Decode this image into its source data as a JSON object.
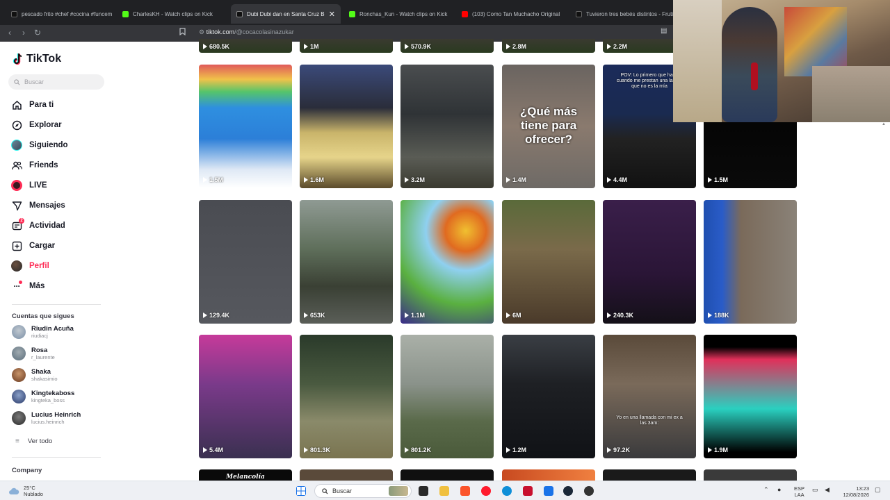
{
  "browser": {
    "tabs": [
      {
        "title": "pescado frito #chef #cocina #funcem",
        "favicon_color": "#111111"
      },
      {
        "title": "CharlesKH - Watch clips on Kick",
        "favicon_color": "#53fc18"
      },
      {
        "title": "Dubi Dubi dan en Santa Cruz Bol",
        "favicon_color": "#111111",
        "active": true
      },
      {
        "title": "Ronchas_Kun - Watch clips on Kick",
        "favicon_color": "#53fc18"
      },
      {
        "title": "(103) Como Tan Muchacho Original",
        "favicon_color": "#ff0000"
      },
      {
        "title": "Tuvieron tres bebés distintos - Fruti",
        "favicon_color": "#111111"
      }
    ],
    "url_host": "tiktok.com",
    "url_path": "/@cocacolasinazukar"
  },
  "sidebar": {
    "logo": "TikTok",
    "search_placeholder": "Buscar",
    "nav": [
      {
        "label": "Para ti",
        "icon": "home-icon"
      },
      {
        "label": "Explorar",
        "icon": "compass-icon"
      },
      {
        "label": "Siguiendo",
        "icon": "avatar-icon"
      },
      {
        "label": "Friends",
        "icon": "friends-icon"
      },
      {
        "label": "LIVE",
        "icon": "live-icon"
      },
      {
        "label": "Mensajes",
        "icon": "send-icon"
      },
      {
        "label": "Actividad",
        "icon": "activity-icon",
        "badge": "2"
      },
      {
        "label": "Cargar",
        "icon": "upload-icon"
      },
      {
        "label": "Perfil",
        "icon": "profile-icon"
      },
      {
        "label": "Más",
        "icon": "more-icon"
      }
    ],
    "following_title": "Cuentas que sigues",
    "following": [
      {
        "name": "Riudin Acuña",
        "user": "riudiacj",
        "color": "#7a8fa6"
      },
      {
        "name": "Rosa",
        "user": "r_laurente",
        "color": "#5b6e7c"
      },
      {
        "name": "Shaka",
        "user": "shakasimio",
        "color": "#8a5a3c"
      },
      {
        "name": "Kingtekaboss",
        "user": "kingteka_boss",
        "color": "#3d5a8a"
      },
      {
        "name": "Lucius Heinrich",
        "user": "lucius.heinrich",
        "color": "#4a4a4a"
      }
    ],
    "see_all": "Ver todo",
    "company": "Company"
  },
  "grid": {
    "top_row_views": [
      "680.5K",
      "1M",
      "570.9K",
      "2.8M",
      "2.2M"
    ],
    "rows": [
      [
        {
          "views": "1.5M",
          "bg": "linear-gradient(180deg,#e05a5a 0%,#f0c24a 12%,#55c46a 22%,#2e8fe0 35%,#2c7fd8 60%,#dfe9f5 85%,#ffffff 100%)"
        },
        {
          "views": "1.6M",
          "bg": "linear-gradient(180deg,#3b4a7a 0%,#2a2d3a 35%,#c9b46a 55%,#e6d48a 75%,#5a4a2a 100%)"
        },
        {
          "views": "3.2M",
          "bg": "linear-gradient(180deg,#4a4d4f 0%,#2f3336 40%,#5a5c55 75%,#3a3a30 100%)"
        },
        {
          "views": "1.4M",
          "bg": "linear-gradient(180deg,#6a6460 0%,#8a7a6e 50%,#6e6a66 100%)",
          "overlay": "¿Qué más tiene para ofrecer?"
        },
        {
          "views": "4.4M",
          "bg": "linear-gradient(180deg,#1b2b5a 0%,#1a2a50 40%,#222 60%,#111 100%)",
          "overlay_small": "POV: Lo primero que hago cuando me prestan una laptop que no es la mía"
        },
        {
          "views": "1.5M",
          "bg": "linear-gradient(180deg,#000 0%,#0a0a0a 100%)"
        }
      ],
      [
        {
          "views": "129.4K",
          "bg": "linear-gradient(180deg,#4a4c52 0%,#56585e 100%)"
        },
        {
          "views": "653K",
          "bg": "linear-gradient(180deg,#8f9a93 0%,#5e6e5a 40%,#3a4034 70%,#5a5e58 100%)"
        },
        {
          "views": "1.1M",
          "bg": "radial-gradient(circle at 70% 25%,#f0c030 0%,#e06a20 18%,#8fd0f0 35%,#5ab040 65%,#3a2a8a 100%)"
        },
        {
          "views": "6M",
          "bg": "linear-gradient(180deg,#5a6a3a 0%,#7a6a4a 40%,#4a3a2a 100%)"
        },
        {
          "views": "240.3K",
          "bg": "linear-gradient(180deg,#3a1f4a 0%,#2a1536 60%,#141018 100%)"
        },
        {
          "views": "188K",
          "bg": "linear-gradient(90deg,#1f4fb0 0%,#2a5cc8 20%,#7a6a5a 40%,#8a8278 100%)"
        }
      ],
      [
        {
          "views": "5.4M",
          "bg": "linear-gradient(180deg,#c63a9a 0%,#7a3a8a 40%,#3a3050 100%)"
        },
        {
          "views": "801.3K",
          "bg": "linear-gradient(180deg,#2a3a2a 0%,#4a5a40 40%,#8a8a6a 70%,#7a7450 100%)"
        },
        {
          "views": "801.2K",
          "bg": "linear-gradient(180deg,#aab0a8 0%,#8a928a 40%,#5a6a4a 70%,#4a5a3a 100%)"
        },
        {
          "views": "1.2M",
          "bg": "linear-gradient(180deg,#3a3e44 0%,#1e2024 40%,#101216 100%)"
        },
        {
          "views": "97.2K",
          "bg": "linear-gradient(180deg,#5a4a3a 0%,#7a6a5a 40%,#3a3a3c 100%)",
          "overlay_small": "Yo en una llamada con mi ex a las 3am:"
        },
        {
          "views": "1.9M",
          "bg": "linear-gradient(180deg,#000 0%,#000 10%,#e0305a 20%,#2ad0c0 60%,#000 95%)"
        }
      ]
    ],
    "bottom_row_caption": "Melancolía"
  },
  "taskbar": {
    "temp": "25°C",
    "condition": "Nublado",
    "search_placeholder": "Buscar",
    "lang": "ESP",
    "lang2": "LAA",
    "time": "13:23",
    "date": "12/08/2026"
  }
}
